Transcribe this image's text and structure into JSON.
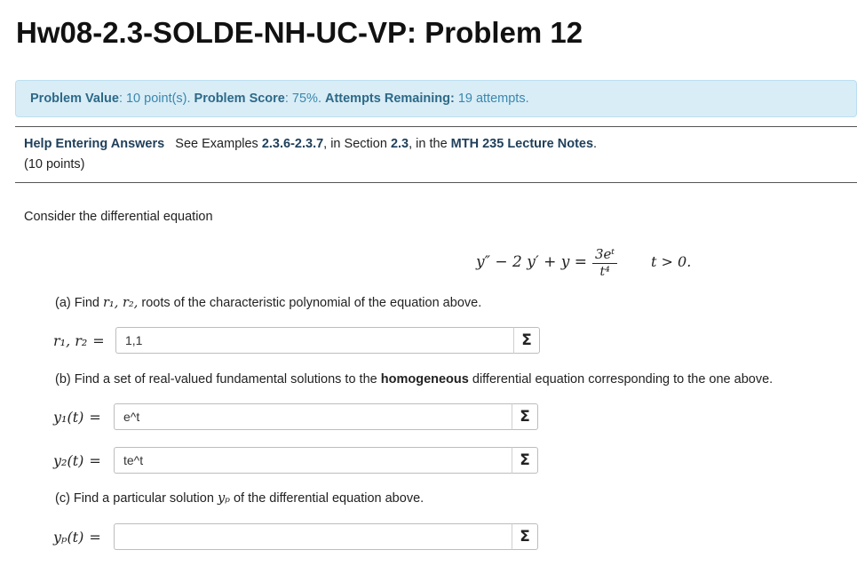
{
  "title": "Hw08-2.3-SOLDE-NH-UC-VP: Problem 12",
  "info": {
    "value_label": "Problem Value",
    "value_text": ": 10 point(s).",
    "score_label": "Problem Score",
    "score_text": ": 75%.",
    "attempts_label": "Attempts Remaining:",
    "attempts_text": "19 attempts."
  },
  "help": {
    "link": "Help Entering Answers",
    "see": "See Examples",
    "examples": "2.3.6-2.3.7",
    "in_section": ", in Section",
    "section": "2.3",
    "in_the": ", in the",
    "notes": "MTH 235 Lecture Notes",
    "period": ".",
    "points": "(10 points)"
  },
  "problem": {
    "intro": "Consider the differential equation",
    "equation_lhs": "y″ − 2 y′ + y =",
    "frac_num": "3eᵗ",
    "frac_den": "t⁴",
    "condition": "t > 0.",
    "part_a": {
      "prefix": "(a) Find",
      "var": "r₁, r₂,",
      "suffix": "roots of the characteristic polynomial of the equation above.",
      "label": "r₁, r₂",
      "value": "1,1"
    },
    "part_b": {
      "prefix": "(b) Find a set of real-valued fundamental solutions to the",
      "bold": "homogeneous",
      "suffix": "differential equation corresponding to the one above.",
      "y1_label": "y₁(t)",
      "y1_value": "e^t",
      "y2_label": "y₂(t)",
      "y2_value": "te^t"
    },
    "part_c": {
      "prefix": "(c) Find a particular solution",
      "var": "yₚ",
      "suffix": "of the differential equation above.",
      "yp_label": "yₚ(t)",
      "yp_value": ""
    },
    "equals": "=",
    "sigma": "Σ"
  }
}
